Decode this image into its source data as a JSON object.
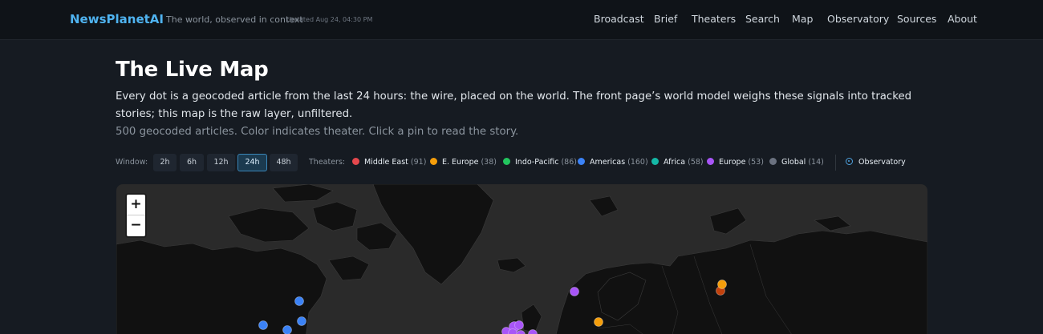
{
  "header": {
    "brand": "NewsPlanetAI",
    "tagline": "The world, observed in context",
    "updated": "Updated Aug 24, 04:30 PM",
    "nav": [
      "Broadcast",
      "Brief",
      "Theaters",
      "Search",
      "Map",
      "Observatory",
      "Sources",
      "About"
    ]
  },
  "page": {
    "title": "The Live Map",
    "description": "Every dot is a geocoded article from the last 24 hours: the wire, placed on the world. The front page’s world model weighs these signals into tracked stories; this map is the raw layer, unfiltered.",
    "subtitle": "500 geocoded articles. Color indicates theater. Click a pin to read the story."
  },
  "controls": {
    "window_label": "Window:",
    "windows": [
      "2h",
      "6h",
      "12h",
      "24h",
      "48h"
    ],
    "active_window": "24h",
    "theaters_label": "Theaters:",
    "theaters": [
      {
        "name": "Middle East",
        "count": "(91)",
        "color": "#e5484d"
      },
      {
        "name": "E. Europe",
        "count": "(38)",
        "color": "#f59e0b"
      },
      {
        "name": "Indo-Pacific",
        "count": "(86)",
        "color": "#22c55e"
      },
      {
        "name": "Americas",
        "count": "(160)",
        "color": "#3b82f6"
      },
      {
        "name": "Africa",
        "count": "(58)",
        "color": "#14b8a6"
      },
      {
        "name": "Europe",
        "count": "(53)",
        "color": "#a855f7"
      },
      {
        "name": "Global",
        "count": "(14)",
        "color": "#6b7280"
      }
    ],
    "observatory_label": "Observatory"
  },
  "map": {
    "zoom_in": "+",
    "zoom_out": "−"
  }
}
